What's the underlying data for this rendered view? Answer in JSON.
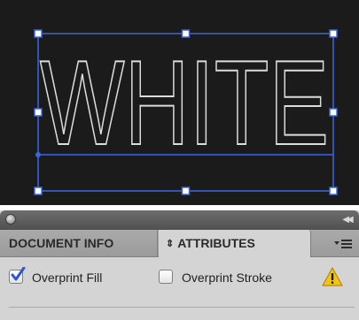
{
  "artboard": {
    "text": "WHITE",
    "background": "#1b1b1b",
    "outline_color": "#dcdcdc",
    "selection_color": "#2e5bd6"
  },
  "panel": {
    "tabs": [
      {
        "label": "DOCUMENT INFO",
        "active": false
      },
      {
        "label": "ATTRIBUTES",
        "active": true,
        "icon": "up-down-arrows-icon"
      }
    ],
    "options": {
      "overprint_fill": {
        "label": "Overprint Fill",
        "checked": true
      },
      "overprint_stroke": {
        "label": "Overprint Stroke",
        "checked": false
      }
    },
    "warning_icon": "warning-triangle-icon",
    "accent": "#2d55d8"
  }
}
